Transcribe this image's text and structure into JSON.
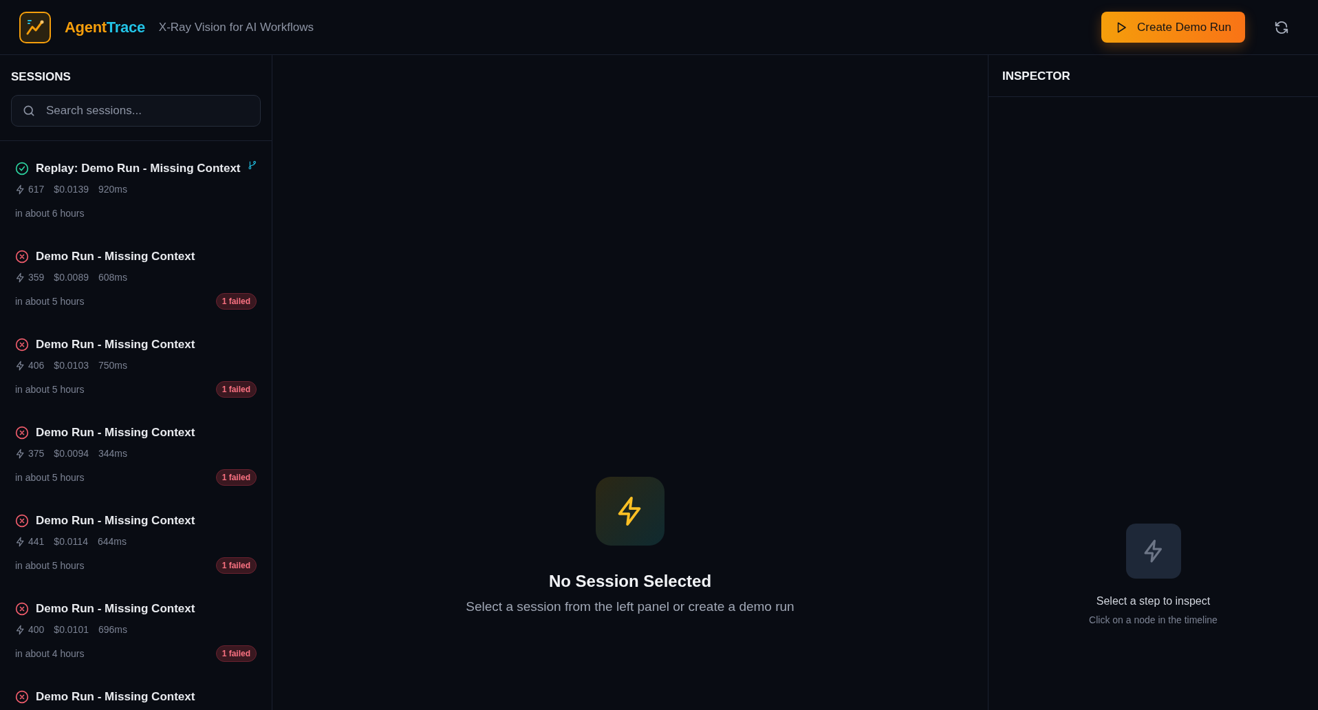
{
  "header": {
    "brand": {
      "lead": "Agent",
      "tail": "Trace"
    },
    "tagline": "X-Ray Vision for AI Workflows",
    "create_button": "Create Demo Run"
  },
  "sessions": {
    "title": "SESSIONS",
    "search": {
      "placeholder": "Search sessions..."
    },
    "items": [
      {
        "kind": "success",
        "title": "Replay: Demo Run - Missing Context",
        "replay": true,
        "tokens": "617",
        "cost": "$0.0139",
        "duration": "920ms",
        "time": "in about 6 hours"
      },
      {
        "kind": "failed",
        "title": "Demo Run - Missing Context",
        "replay": false,
        "tokens": "359",
        "cost": "$0.0089",
        "duration": "608ms",
        "time": "in about 5 hours",
        "badge": "1 failed"
      },
      {
        "kind": "failed",
        "title": "Demo Run - Missing Context",
        "replay": false,
        "tokens": "406",
        "cost": "$0.0103",
        "duration": "750ms",
        "time": "in about 5 hours",
        "badge": "1 failed"
      },
      {
        "kind": "failed",
        "title": "Demo Run - Missing Context",
        "replay": false,
        "tokens": "375",
        "cost": "$0.0094",
        "duration": "344ms",
        "time": "in about 5 hours",
        "badge": "1 failed"
      },
      {
        "kind": "failed",
        "title": "Demo Run - Missing Context",
        "replay": false,
        "tokens": "441",
        "cost": "$0.0114",
        "duration": "644ms",
        "time": "in about 5 hours",
        "badge": "1 failed"
      },
      {
        "kind": "failed",
        "title": "Demo Run - Missing Context",
        "replay": false,
        "tokens": "400",
        "cost": "$0.0101",
        "duration": "696ms",
        "time": "in about 4 hours",
        "badge": "1 failed"
      },
      {
        "kind": "failed",
        "title": "Demo Run - Missing Context",
        "replay": false
      }
    ]
  },
  "main": {
    "title": "No Session Selected",
    "subtitle": "Select a session from the left panel or create a demo run"
  },
  "inspector": {
    "title": "INSPECTOR",
    "empty_title": "Select a step to inspect",
    "empty_hint": "Click on a node in the timeline"
  }
}
